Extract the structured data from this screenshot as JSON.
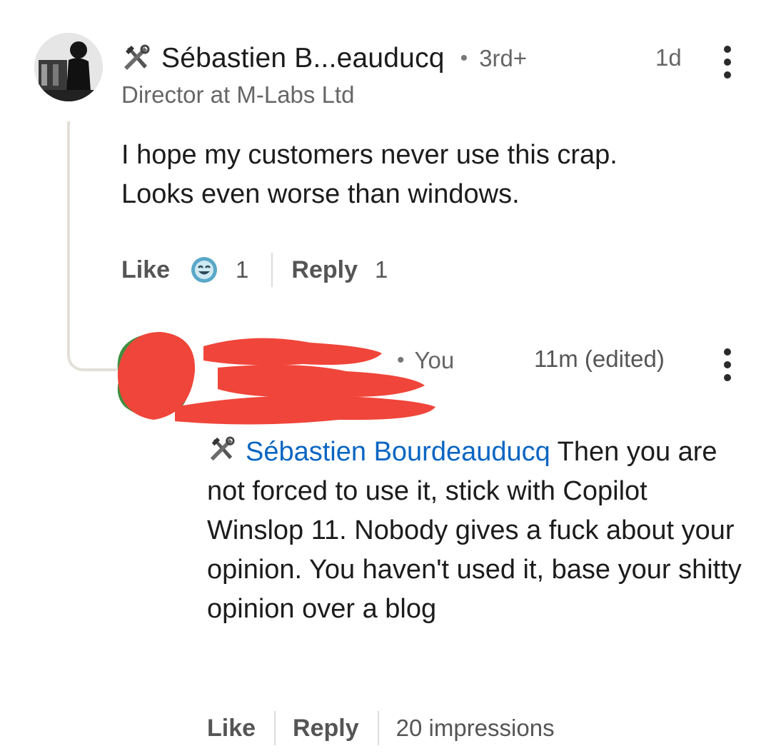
{
  "comment": {
    "author": "Sébastien B...eauducq",
    "separator": "•",
    "degree": "3rd+",
    "time": "1d",
    "headline": "Director at M-Labs Ltd",
    "text_line1": "I hope my customers never use this crap.",
    "text_line2": "Looks even worse than windows.",
    "like_label": "Like",
    "reaction_count": "1",
    "reply_label": "Reply",
    "reply_count": "1"
  },
  "reply": {
    "separator": "•",
    "author_badge": "You",
    "time": "11m (edited)",
    "mention": "Sébastien Bourdeauducq",
    "text": " Then you are not forced to use it, stick with Copilot Winslop 11. Nobody gives a fuck about your opinion. You haven't used it, base your shitty opinion over a blog",
    "like_label": "Like",
    "reply_label": "Reply",
    "impressions": "20 impressions"
  },
  "colors": {
    "mention": "#0a66c2",
    "redaction": "#f0453a",
    "reaction_badge": "#5aa8c8"
  },
  "icons": {
    "author_badge_icon": "hammer-wrench-icon",
    "reaction_icon": "funny-reaction-icon",
    "menu_icon": "kebab-menu-icon"
  }
}
